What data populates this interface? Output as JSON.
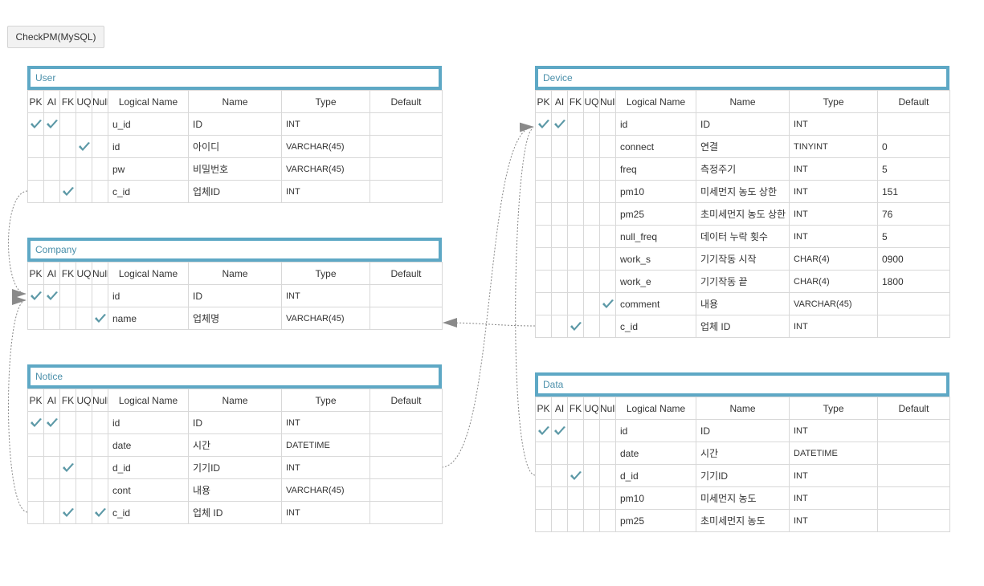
{
  "db_button": "CheckPM(MySQL)",
  "headers": [
    "PK",
    "AI",
    "FK",
    "UQ",
    "Null",
    "Logical Name",
    "Name",
    "Type",
    "Default"
  ],
  "entities": [
    {
      "title": "User",
      "rows": [
        {
          "pk": true,
          "ai": true,
          "fk": false,
          "uq": false,
          "nl": false,
          "logical": "u_id",
          "name": "ID",
          "type": "INT",
          "def": ""
        },
        {
          "pk": false,
          "ai": false,
          "fk": false,
          "uq": true,
          "nl": false,
          "logical": "id",
          "name": "아이디",
          "type": "VARCHAR(45)",
          "def": ""
        },
        {
          "pk": false,
          "ai": false,
          "fk": false,
          "uq": false,
          "nl": false,
          "logical": "pw",
          "name": "비밀번호",
          "type": "VARCHAR(45)",
          "def": ""
        },
        {
          "pk": false,
          "ai": false,
          "fk": true,
          "uq": false,
          "nl": false,
          "logical": "c_id",
          "name": "업체ID",
          "type": "INT",
          "def": ""
        }
      ]
    },
    {
      "title": "Company",
      "rows": [
        {
          "pk": true,
          "ai": true,
          "fk": false,
          "uq": false,
          "nl": false,
          "logical": "id",
          "name": "ID",
          "type": "INT",
          "def": ""
        },
        {
          "pk": false,
          "ai": false,
          "fk": false,
          "uq": false,
          "nl": true,
          "logical": "name",
          "name": "업체명",
          "type": "VARCHAR(45)",
          "def": ""
        }
      ]
    },
    {
      "title": "Notice",
      "rows": [
        {
          "pk": true,
          "ai": true,
          "fk": false,
          "uq": false,
          "nl": false,
          "logical": "id",
          "name": "ID",
          "type": "INT",
          "def": ""
        },
        {
          "pk": false,
          "ai": false,
          "fk": false,
          "uq": false,
          "nl": false,
          "logical": "date",
          "name": "시간",
          "type": "DATETIME",
          "def": ""
        },
        {
          "pk": false,
          "ai": false,
          "fk": true,
          "uq": false,
          "nl": false,
          "logical": "d_id",
          "name": "기기ID",
          "type": "INT",
          "def": ""
        },
        {
          "pk": false,
          "ai": false,
          "fk": false,
          "uq": false,
          "nl": false,
          "logical": "cont",
          "name": "내용",
          "type": "VARCHAR(45)",
          "def": ""
        },
        {
          "pk": false,
          "ai": false,
          "fk": true,
          "uq": false,
          "nl": true,
          "logical": "c_id",
          "name": "업체 ID",
          "type": "INT",
          "def": ""
        }
      ]
    },
    {
      "title": "Device",
      "rows": [
        {
          "pk": true,
          "ai": true,
          "fk": false,
          "uq": false,
          "nl": false,
          "logical": "id",
          "name": "ID",
          "type": "INT",
          "def": ""
        },
        {
          "pk": false,
          "ai": false,
          "fk": false,
          "uq": false,
          "nl": false,
          "logical": "connect",
          "name": "연결",
          "type": "TINYINT",
          "def": "0"
        },
        {
          "pk": false,
          "ai": false,
          "fk": false,
          "uq": false,
          "nl": false,
          "logical": "freq",
          "name": "측정주기",
          "type": "INT",
          "def": "5"
        },
        {
          "pk": false,
          "ai": false,
          "fk": false,
          "uq": false,
          "nl": false,
          "logical": "pm10",
          "name": "미세먼지 농도 상한",
          "type": "INT",
          "def": "151"
        },
        {
          "pk": false,
          "ai": false,
          "fk": false,
          "uq": false,
          "nl": false,
          "logical": "pm25",
          "name": "초미세먼지 농도 상한",
          "type": "INT",
          "def": "76"
        },
        {
          "pk": false,
          "ai": false,
          "fk": false,
          "uq": false,
          "nl": false,
          "logical": "null_freq",
          "name": "데이터 누락 횟수",
          "type": "INT",
          "def": "5"
        },
        {
          "pk": false,
          "ai": false,
          "fk": false,
          "uq": false,
          "nl": false,
          "logical": "work_s",
          "name": "기기작동 시작",
          "type": "CHAR(4)",
          "def": "0900"
        },
        {
          "pk": false,
          "ai": false,
          "fk": false,
          "uq": false,
          "nl": false,
          "logical": "work_e",
          "name": "기기작동 끝",
          "type": "CHAR(4)",
          "def": "1800"
        },
        {
          "pk": false,
          "ai": false,
          "fk": false,
          "uq": false,
          "nl": true,
          "logical": "comment",
          "name": "내용",
          "type": "VARCHAR(45)",
          "def": ""
        },
        {
          "pk": false,
          "ai": false,
          "fk": true,
          "uq": false,
          "nl": false,
          "logical": "c_id",
          "name": "업체 ID",
          "type": "INT",
          "def": ""
        }
      ]
    },
    {
      "title": "Data",
      "rows": [
        {
          "pk": true,
          "ai": true,
          "fk": false,
          "uq": false,
          "nl": false,
          "logical": "id",
          "name": "ID",
          "type": "INT",
          "def": ""
        },
        {
          "pk": false,
          "ai": false,
          "fk": false,
          "uq": false,
          "nl": false,
          "logical": "date",
          "name": "시간",
          "type": "DATETIME",
          "def": ""
        },
        {
          "pk": false,
          "ai": false,
          "fk": true,
          "uq": false,
          "nl": false,
          "logical": "d_id",
          "name": "기기ID",
          "type": "INT",
          "def": ""
        },
        {
          "pk": false,
          "ai": false,
          "fk": false,
          "uq": false,
          "nl": false,
          "logical": "pm10",
          "name": "미세먼지 농도",
          "type": "INT",
          "def": ""
        },
        {
          "pk": false,
          "ai": false,
          "fk": false,
          "uq": false,
          "nl": false,
          "logical": "pm25",
          "name": "초미세먼지 농도",
          "type": "INT",
          "def": ""
        }
      ]
    }
  ],
  "colors": {
    "entity_border": "#5ea8c5",
    "title_text": "#4a8faa",
    "check": "#5b98a6",
    "link": "#888888"
  }
}
